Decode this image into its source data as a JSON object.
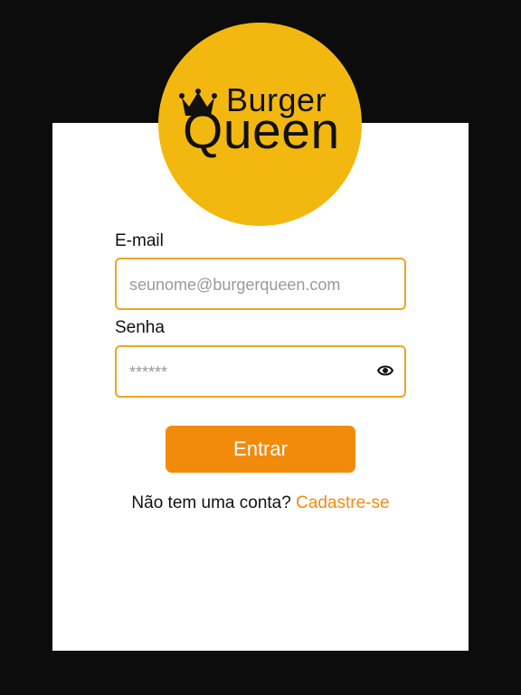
{
  "brand": {
    "line1": "Burger",
    "line2": "Queen",
    "icon": "crown-icon"
  },
  "form": {
    "email": {
      "label": "E-mail",
      "placeholder": "seunome@burgerqueen.com"
    },
    "password": {
      "label": "Senha",
      "placeholder": "******",
      "toggle_icon": "eye-icon"
    },
    "submit_label": "Entrar",
    "signup_prompt": "Não tem uma conta?",
    "signup_link": "Cadastre-se"
  },
  "colors": {
    "accent": "#f28b0c",
    "logo_bg": "#f3b80f",
    "border": "#f3a51d",
    "background": "#0c0c0c"
  }
}
